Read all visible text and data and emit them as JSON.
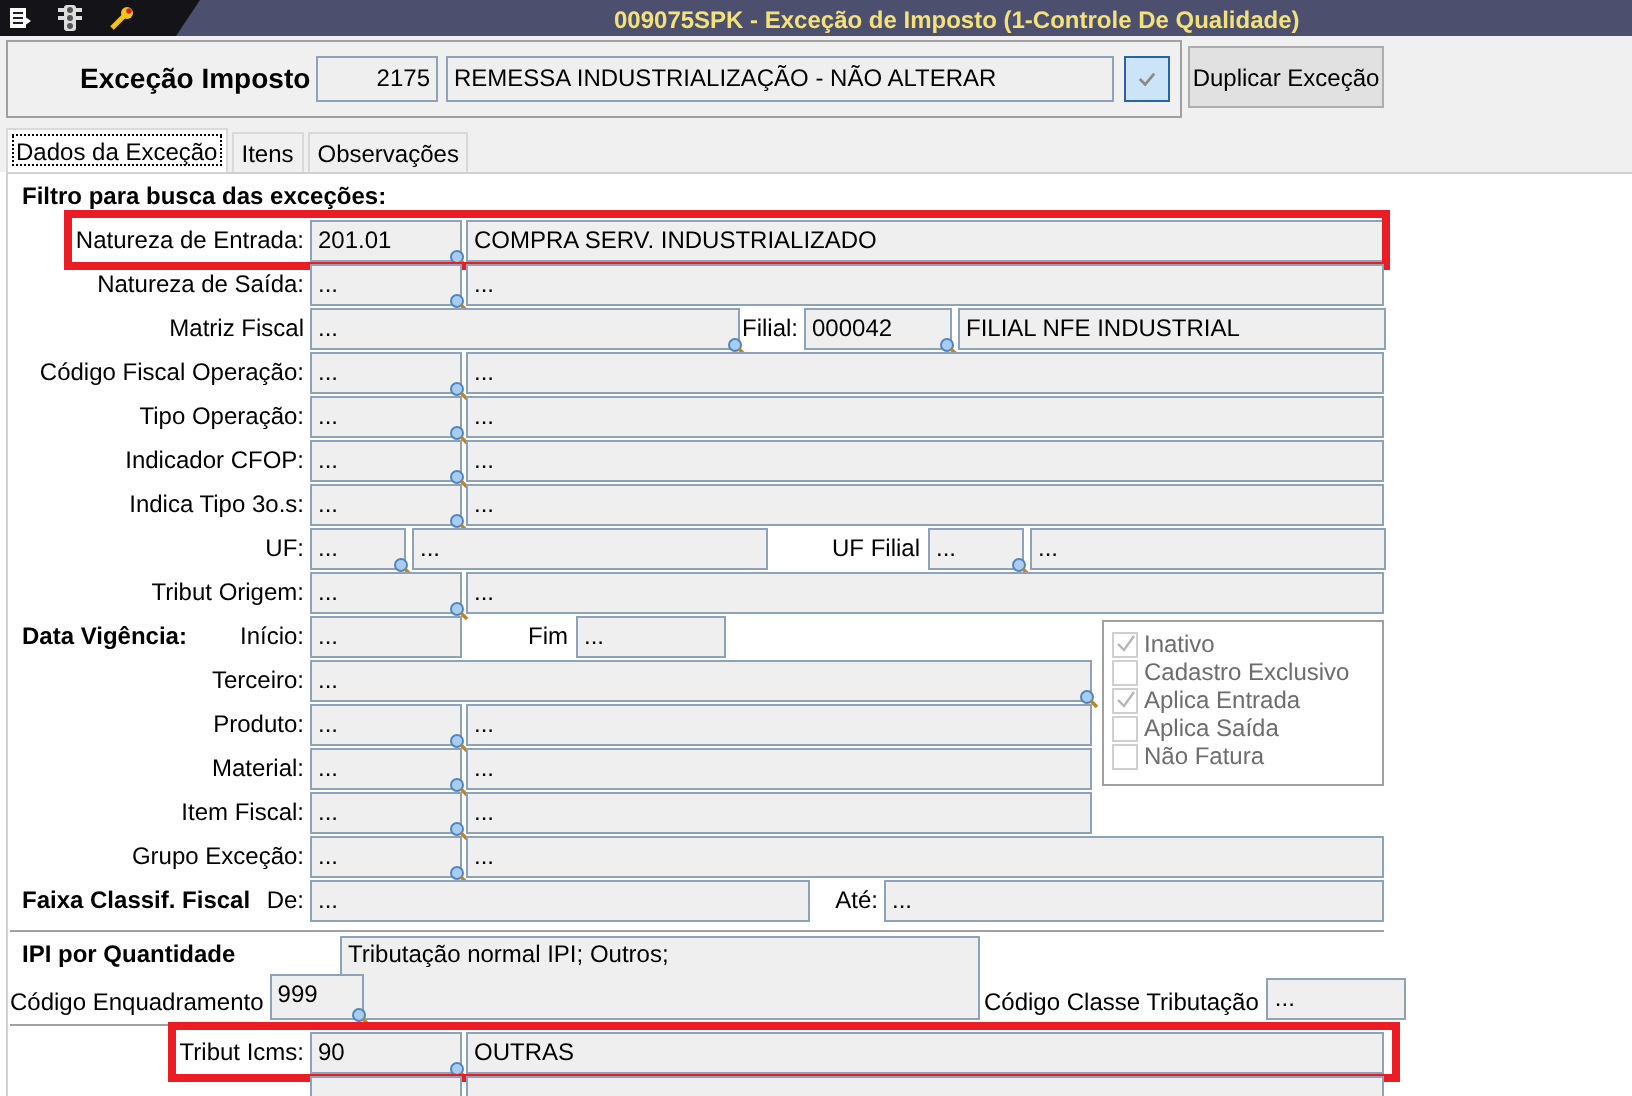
{
  "window": {
    "title": "009075SPK - Exceção de Imposto (1-Controle De Qualidade)"
  },
  "header": {
    "label": "Exceção Imposto",
    "code": "2175",
    "description": "REMESSA INDUSTRIALIZAÇÃO - NÃO ALTERAR",
    "button": "Duplicar Exceção"
  },
  "tabs": [
    {
      "label": "Dados da Exceção",
      "selected": true
    },
    {
      "label": "Itens",
      "selected": false
    },
    {
      "label": "Observações",
      "selected": false
    }
  ],
  "filter_title": "Filtro para busca das exceções:",
  "rows": [
    {
      "kind": "lookup",
      "label": "Natureza de Entrada:",
      "values": [
        "201.01",
        "COMPRA SERV. INDUSTRIALIZADO"
      ],
      "highlighted": true
    },
    {
      "kind": "lookup",
      "label": "Natureza de Saída:",
      "values": [
        "...",
        "..."
      ],
      "highlighted": false
    },
    {
      "kind": "matriz",
      "label": "Matriz Fiscal",
      "label2": "Filial:",
      "values": [
        "...",
        "000042",
        "FILIAL NFE INDUSTRIAL"
      ],
      "highlighted": false
    },
    {
      "kind": "lookup",
      "label": "Código Fiscal Operação:",
      "values": [
        "...",
        "..."
      ],
      "highlighted": false
    },
    {
      "kind": "lookup",
      "label": "Tipo Operação:",
      "values": [
        "...",
        "..."
      ],
      "highlighted": false
    },
    {
      "kind": "lookup",
      "label": "Indicador CFOP:",
      "values": [
        "...",
        "..."
      ],
      "highlighted": false
    },
    {
      "kind": "lookup",
      "label": "Indica Tipo 3o.s:",
      "values": [
        "...",
        "..."
      ],
      "highlighted": false
    },
    {
      "kind": "uf",
      "label": "UF:",
      "label2": "UF Filial",
      "values": [
        "...",
        "...",
        "...",
        "..."
      ],
      "highlighted": false
    },
    {
      "kind": "lookup",
      "label": "Tribut Origem:",
      "values": [
        "...",
        "..."
      ],
      "highlighted": false
    },
    {
      "kind": "vigencia",
      "section": "Data Vigência:",
      "label": "Início:",
      "label2": "Fim",
      "values": [
        "...",
        "..."
      ],
      "highlighted": false
    },
    {
      "kind": "terceiro",
      "label": "Terceiro:",
      "values": [
        "..."
      ],
      "highlighted": false
    },
    {
      "kind": "short",
      "label": "Produto:",
      "values": [
        "...",
        "..."
      ],
      "highlighted": false
    },
    {
      "kind": "short",
      "label": "Material:",
      "values": [
        "...",
        "..."
      ],
      "highlighted": false
    },
    {
      "kind": "short",
      "label": "Item Fiscal:",
      "values": [
        "...",
        "..."
      ],
      "highlighted": false
    },
    {
      "kind": "lookup",
      "label": "Grupo Exceção:",
      "values": [
        "...",
        "..."
      ],
      "highlighted": false
    },
    {
      "kind": "faixa",
      "section": "Faixa Classif. Fiscal",
      "label": "De:",
      "label2": "Até:",
      "values": [
        "...",
        "..."
      ],
      "highlighted": false
    }
  ],
  "checkboxes": [
    {
      "label": "Inativo",
      "checked": true,
      "disabled": true
    },
    {
      "label": "Cadastro Exclusivo",
      "checked": false,
      "disabled": true
    },
    {
      "label": "Aplica Entrada",
      "checked": true,
      "disabled": true
    },
    {
      "label": "Aplica Saída",
      "checked": false,
      "disabled": true
    },
    {
      "label": "Não Fatura",
      "checked": false,
      "disabled": true
    }
  ],
  "ipi": {
    "title": "IPI por Quantidade",
    "description": "Tributação normal IPI; Outros;",
    "code_label": "Código Enquadramento",
    "code": "999",
    "class_label": "Código Classe Tributação",
    "class_value": "..."
  },
  "bottom_rows": [
    {
      "kind": "lookup",
      "label": "Tribut Icms:",
      "values": [
        "90",
        "OUTRAS"
      ],
      "highlighted": true
    },
    {
      "kind": "lookup_cut",
      "values": [],
      "highlighted": false
    }
  ]
}
